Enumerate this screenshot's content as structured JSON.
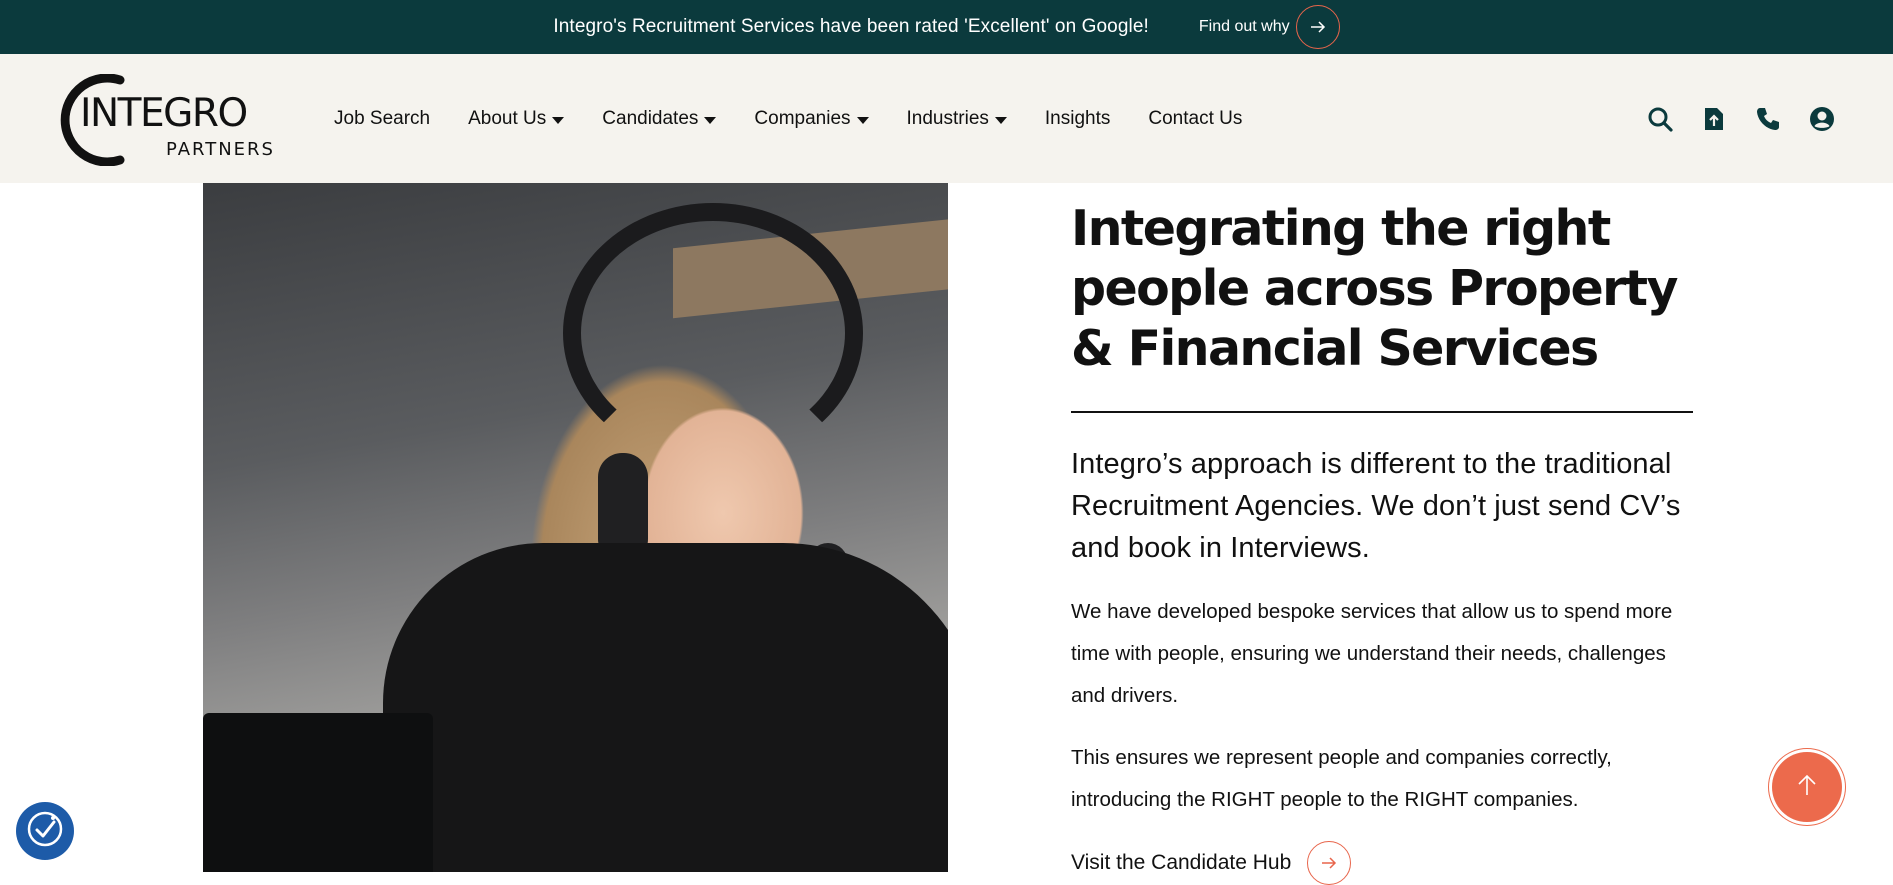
{
  "announcement": {
    "text": "Integro's Recruitment Services have been rated 'Excellent' on Google!",
    "link_label": "Find out why"
  },
  "brand": {
    "logo_word": "INTEGRO",
    "logo_sub": "PARTNERS",
    "accent_color": "#e8654b",
    "dark_color": "#0b3a3d"
  },
  "nav": {
    "items": [
      {
        "label": "Job Search",
        "dropdown": false
      },
      {
        "label": "About Us",
        "dropdown": true
      },
      {
        "label": "Candidates",
        "dropdown": true
      },
      {
        "label": "Companies",
        "dropdown": true
      },
      {
        "label": "Industries",
        "dropdown": true
      },
      {
        "label": "Insights",
        "dropdown": false
      },
      {
        "label": "Contact Us",
        "dropdown": false
      }
    ],
    "icons": [
      "search-icon",
      "upload-cv-icon",
      "phone-icon",
      "account-icon"
    ]
  },
  "hero": {
    "image_alt": "Woman wearing a headset working at a desk",
    "headline": "Integrating the right people across Property & Financial Services",
    "lead": "Integro’s approach is different to the traditional Recruitment Agencies. We don’t just send CV’s and book in Interviews.",
    "paragraph_1": "We have developed bespoke services that allow us to spend more time with people, ensuring we understand their needs, challenges and drivers.",
    "paragraph_2": "This ensures we represent people and companies correctly, introducing the RIGHT people to the RIGHT companies.",
    "cta_label": "Visit the Candidate Hub"
  },
  "floating": {
    "scroll_top_icon": "arrow-up-icon",
    "accessibility_icon": "accessibility-icon"
  }
}
